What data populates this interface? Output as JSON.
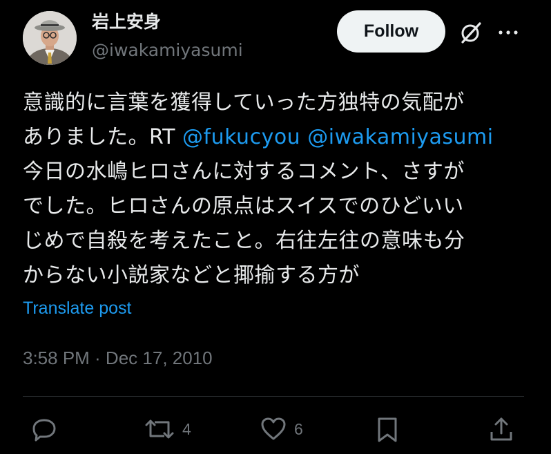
{
  "user": {
    "display_name": "岩上安身",
    "handle": "@iwakamiyasumi"
  },
  "header": {
    "follow_label": "Follow",
    "grok_icon": "grok-icon",
    "more_icon": "more-icon"
  },
  "tweet": {
    "line1": "意識的に言葉を獲得していった方独特の気配が",
    "line2_text": "ありました。RT ",
    "mention1": "@fukucyou",
    "space": " ",
    "mention2": "@iwakamiyasumi",
    "line3": "今日の水嶋ヒロさんに対するコメント、さすが",
    "line4": "でした。ヒロさんの原点はスイスでのひどいい",
    "line5": "じめで自殺を考えたこと。右往左往の意味も分",
    "line6": "からない小説家などと揶揄する方が"
  },
  "translate_label": "Translate post",
  "timestamp": "3:58 PM · Dec 17, 2010",
  "actions": {
    "reply_icon": "reply-icon",
    "retweet_icon": "retweet-icon",
    "retweet_count": "4",
    "like_icon": "heart-icon",
    "like_count": "6",
    "bookmark_icon": "bookmark-icon",
    "share_icon": "share-icon"
  },
  "colors": {
    "background": "#000000",
    "text": "#e7e9ea",
    "secondary": "#71767b",
    "link": "#1d9bf0",
    "follow_bg": "#eff3f4"
  }
}
